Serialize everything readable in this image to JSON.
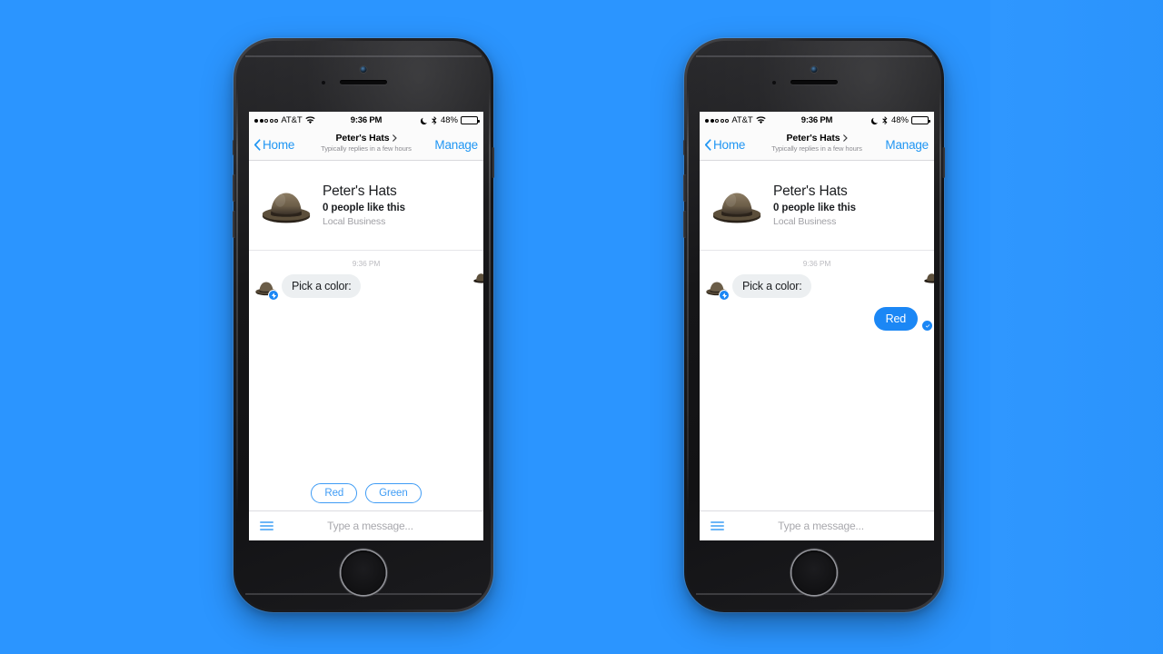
{
  "canvas": {
    "background_color": "#2b95ff",
    "accent_blue": "#1b87f5",
    "link_blue": "#2096f3",
    "pill_blue": "#3f9cf5"
  },
  "status_bar": {
    "signal_label": "signal-dots",
    "carrier": "AT&T",
    "wifi": "wifi-icon",
    "time": "9:36 PM",
    "dnd": "moon-icon",
    "bluetooth": "bluetooth-icon",
    "battery_percent": "48%",
    "battery_level": 48
  },
  "nav_bar": {
    "back_label": "Home",
    "title": "Peter's Hats",
    "subtitle": "Typically replies in a few hours",
    "action_label": "Manage"
  },
  "profile": {
    "name": "Peter's Hats",
    "likes": "0 people like this",
    "category": "Local Business",
    "avatar": "bowler-hat-avatar"
  },
  "thread": {
    "timestamp": "9:36 PM",
    "incoming_message": "Pick a color:",
    "incoming_avatar": "bowler-hat-avatar",
    "incoming_badge": "messenger-bolt-badge",
    "edge_avatar": "bowler-hat-avatar"
  },
  "quick_replies": {
    "options": [
      {
        "label": "Red"
      },
      {
        "label": "Green"
      }
    ]
  },
  "composer": {
    "menu_icon": "hamburger-menu-icon",
    "placeholder": "Type a message..."
  },
  "phones": [
    {
      "id": "left",
      "state_label": "quick-replies-shown",
      "shows_quick_replies": true,
      "shows_sent_reply": false,
      "sent_reply": ""
    },
    {
      "id": "right",
      "state_label": "reply-selected",
      "shows_quick_replies": false,
      "shows_sent_reply": true,
      "sent_reply": "Red",
      "read_receipt": "check-circle-icon"
    }
  ]
}
